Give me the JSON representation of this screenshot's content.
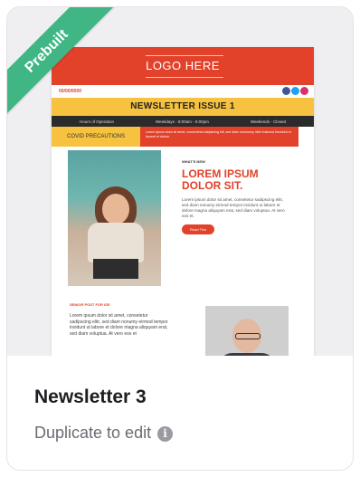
{
  "badge": {
    "label": "Prebuilt"
  },
  "preview": {
    "logo_text": "LOGO HERE",
    "date_text": "00/00/0000",
    "issue_title": "NEWSLETTER ISSUE 1",
    "hours": [
      "Hours of Operation",
      "Weekdays - 8:00am - 5:00pm",
      "Weekends - Closed"
    ],
    "covid_label": "COVID PRECAUTIONS",
    "covid_text": "Lorem ipsum dolor sit amet, consectetur adipiscing elit, sed diam nonummy nibh euismod tincidunt ut laoreet et dolore.",
    "whats_new": "WHAT'S NEW",
    "headline": "LOREM IPSUM DOLOR SIT.",
    "feature_body": "Lorem ipsum dolor sit amet, consetetur sadipscing elitr, sed diam nonumy eirmod tempor invidunt ut labore et dolore magna aliquyam erat, sed diam voluptua. At vero eos et.",
    "read_button": "Read This",
    "section_label": "SENIOR POST FOR ISE",
    "section_body": "Lorem ipsum dolor sit amet, consetetur sadipscing elitr, sed diam nonumy eirmod tempor invidunt ut labore et dolore magna aliquyam erat, sed diam voluptua. At vero eos et",
    "colors": {
      "accent": "#e2412a",
      "yellow": "#f6c23f",
      "dark": "#2b2b2b",
      "badge": "#3fb684"
    },
    "socials": [
      "facebook-icon",
      "twitter-icon",
      "instagram-icon"
    ]
  },
  "card": {
    "title": "Newsletter 3",
    "subtitle": "Duplicate to edit",
    "info_icon": "i"
  }
}
